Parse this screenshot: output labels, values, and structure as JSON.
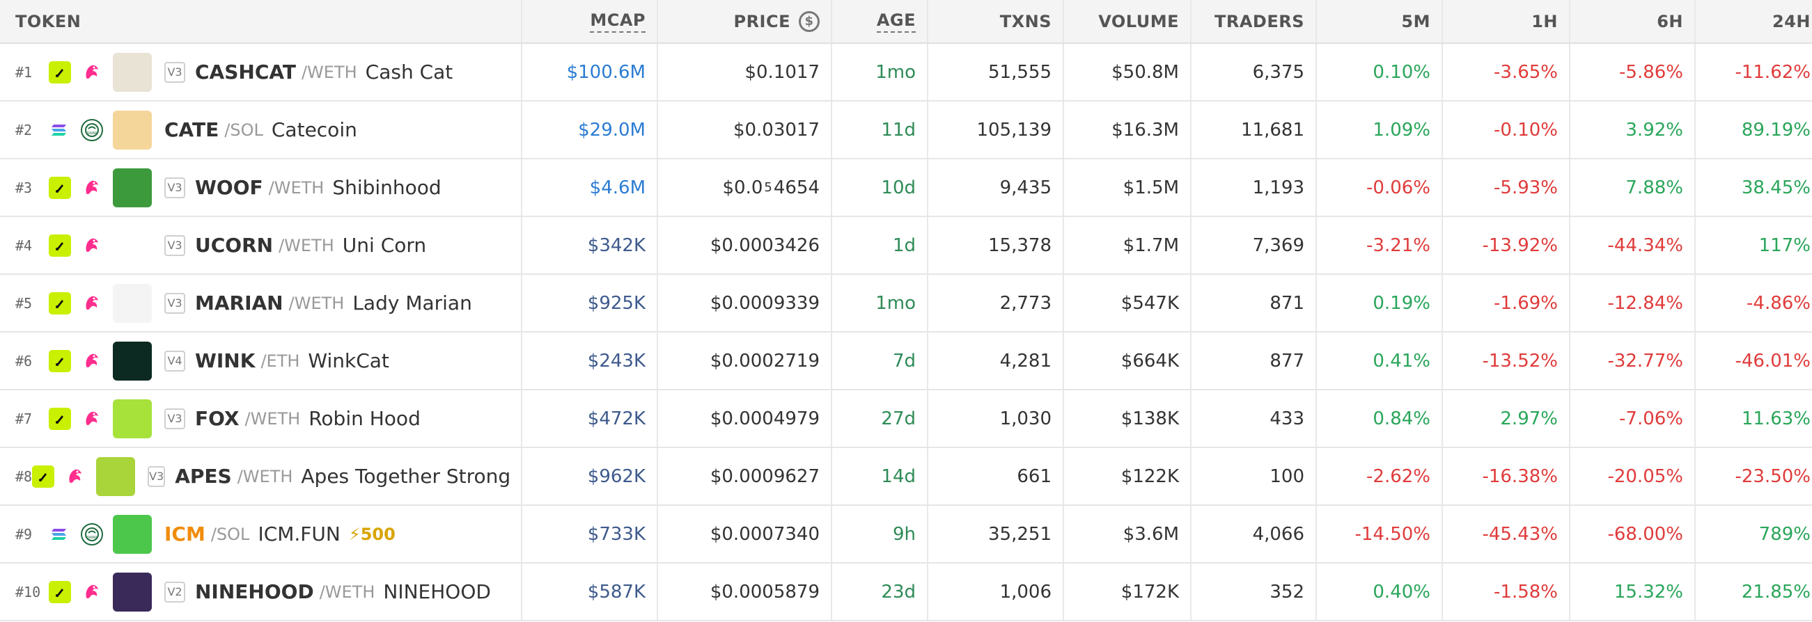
{
  "headers": {
    "token": "TOKEN",
    "mcap": "MCAP",
    "price": "PRICE",
    "age": "AGE",
    "txns": "TXNS",
    "volume": "VOLUME",
    "traders": "TRADERS",
    "m5": "5M",
    "h1": "1H",
    "h6": "6H",
    "h24": "24H",
    "price_icon": "dollar-coin-icon"
  },
  "colors": {
    "positive": "#2aa65a",
    "negative": "#e03b3b",
    "mcap_link": "#2b7cd3",
    "mcap": "#3d5a8c",
    "boost": "#d9a400"
  },
  "rows": [
    {
      "rank": "#1",
      "chain": "eth",
      "dex": "uniswap",
      "ver": "V3",
      "symbol": "CASHCAT",
      "pair": "/WETH",
      "name": "Cash Cat",
      "boost": "",
      "mcap": "$100.6M",
      "mcap_link": true,
      "price": "$0.1017",
      "price_sub": "",
      "price_tail": "",
      "age": "1mo",
      "txns": "51,555",
      "volume": "$50.8M",
      "traders": "6,375",
      "m5": "0.10%",
      "h1": "-3.65%",
      "h6": "-5.86%",
      "h24": "-11.62%",
      "avatar_color": "#e9e3d6",
      "avatar_icon": "cat-avatar"
    },
    {
      "rank": "#2",
      "chain": "sol",
      "dex": "swap",
      "ver": "",
      "symbol": "CATE",
      "pair": "/SOL",
      "name": "Catecoin",
      "boost": "",
      "mcap": "$29.0M",
      "mcap_link": true,
      "price": "$0.03017",
      "price_sub": "",
      "price_tail": "",
      "age": "11d",
      "txns": "105,139",
      "volume": "$16.3M",
      "traders": "11,681",
      "m5": "1.09%",
      "h1": "-0.10%",
      "h6": "3.92%",
      "h24": "89.19%",
      "avatar_color": "#f5d69a",
      "avatar_icon": "catecoin-avatar"
    },
    {
      "rank": "#3",
      "chain": "eth",
      "dex": "uniswap",
      "ver": "V3",
      "symbol": "WOOF",
      "pair": "/WETH",
      "name": "Shibinhood",
      "boost": "",
      "mcap": "$4.6M",
      "mcap_link": true,
      "price": "$0.0",
      "price_sub": "5",
      "price_tail": "4654",
      "age": "10d",
      "txns": "9,435",
      "volume": "$1.5M",
      "traders": "1,193",
      "m5": "-0.06%",
      "h1": "-5.93%",
      "h6": "7.88%",
      "h24": "38.45%",
      "avatar_color": "#3c9a3c",
      "avatar_icon": "shiba-avatar"
    },
    {
      "rank": "#4",
      "chain": "eth",
      "dex": "uniswap",
      "ver": "V3",
      "symbol": "UCORN",
      "pair": "/WETH",
      "name": "Uni Corn",
      "boost": "",
      "mcap": "$342K",
      "mcap_link": false,
      "price": "$0.0003426",
      "price_sub": "",
      "price_tail": "",
      "age": "1d",
      "txns": "15,378",
      "volume": "$1.7M",
      "traders": "7,369",
      "m5": "-3.21%",
      "h1": "-13.92%",
      "h6": "-44.34%",
      "h24": "117%",
      "avatar_color": "#ffffff",
      "avatar_icon": "unicorn-avatar"
    },
    {
      "rank": "#5",
      "chain": "eth",
      "dex": "uniswap",
      "ver": "V3",
      "symbol": "MARIAN",
      "pair": "/WETH",
      "name": "Lady Marian",
      "boost": "",
      "mcap": "$925K",
      "mcap_link": false,
      "price": "$0.0009339",
      "price_sub": "",
      "price_tail": "",
      "age": "1mo",
      "txns": "2,773",
      "volume": "$547K",
      "traders": "871",
      "m5": "0.19%",
      "h1": "-1.69%",
      "h6": "-12.84%",
      "h24": "-4.86%",
      "avatar_color": "#f4f4f4",
      "avatar_icon": "lady-avatar"
    },
    {
      "rank": "#6",
      "chain": "eth",
      "dex": "uniswap",
      "ver": "V4",
      "symbol": "WINK",
      "pair": "/ETH",
      "name": "WinkCat",
      "boost": "",
      "mcap": "$243K",
      "mcap_link": false,
      "price": "$0.0002719",
      "price_sub": "",
      "price_tail": "",
      "age": "7d",
      "txns": "4,281",
      "volume": "$664K",
      "traders": "877",
      "m5": "0.41%",
      "h1": "-13.52%",
      "h6": "-32.77%",
      "h24": "-46.01%",
      "avatar_color": "#0c2a22",
      "avatar_icon": "winkcat-avatar"
    },
    {
      "rank": "#7",
      "chain": "eth",
      "dex": "uniswap",
      "ver": "V3",
      "symbol": "FOX",
      "pair": "/WETH",
      "name": "Robin Hood",
      "boost": "",
      "mcap": "$472K",
      "mcap_link": false,
      "price": "$0.0004979",
      "price_sub": "",
      "price_tail": "",
      "age": "27d",
      "txns": "1,030",
      "volume": "$138K",
      "traders": "433",
      "m5": "0.84%",
      "h1": "2.97%",
      "h6": "-7.06%",
      "h24": "11.63%",
      "avatar_color": "#a6e23a",
      "avatar_icon": "fox-avatar"
    },
    {
      "rank": "#8",
      "chain": "eth",
      "dex": "uniswap",
      "ver": "V3",
      "symbol": "APES",
      "pair": "/WETH",
      "name": "Apes Together Strong",
      "boost": "",
      "mcap": "$962K",
      "mcap_link": false,
      "price": "$0.0009627",
      "price_sub": "",
      "price_tail": "",
      "age": "14d",
      "txns": "661",
      "volume": "$122K",
      "traders": "100",
      "m5": "-2.62%",
      "h1": "-16.38%",
      "h6": "-20.05%",
      "h24": "-23.50%",
      "avatar_color": "#a9d43a",
      "avatar_icon": "ape-avatar"
    },
    {
      "rank": "#9",
      "chain": "sol",
      "dex": "swap",
      "ver": "",
      "symbol": "ICM",
      "pair": "/SOL",
      "name": "ICM.FUN",
      "boost": "⚡500",
      "mcap": "$733K",
      "mcap_link": false,
      "price": "$0.0007340",
      "price_sub": "",
      "price_tail": "",
      "age": "9h",
      "txns": "35,251",
      "volume": "$3.6M",
      "traders": "4,066",
      "m5": "-14.50%",
      "h1": "-45.43%",
      "h6": "-68.00%",
      "h24": "789%",
      "avatar_color": "#4cc74c",
      "avatar_icon": "icm-avatar"
    },
    {
      "rank": "#10",
      "chain": "eth",
      "dex": "uniswap",
      "ver": "V2",
      "symbol": "NINEHOOD",
      "pair": "/WETH",
      "name": "NINEHOOD",
      "boost": "",
      "mcap": "$587K",
      "mcap_link": false,
      "price": "$0.0005879",
      "price_sub": "",
      "price_tail": "",
      "age": "23d",
      "txns": "1,006",
      "volume": "$172K",
      "traders": "352",
      "m5": "0.40%",
      "h1": "-1.58%",
      "h6": "15.32%",
      "h24": "21.85%",
      "avatar_color": "#3a2a5a",
      "avatar_icon": "ninehood-avatar"
    }
  ]
}
